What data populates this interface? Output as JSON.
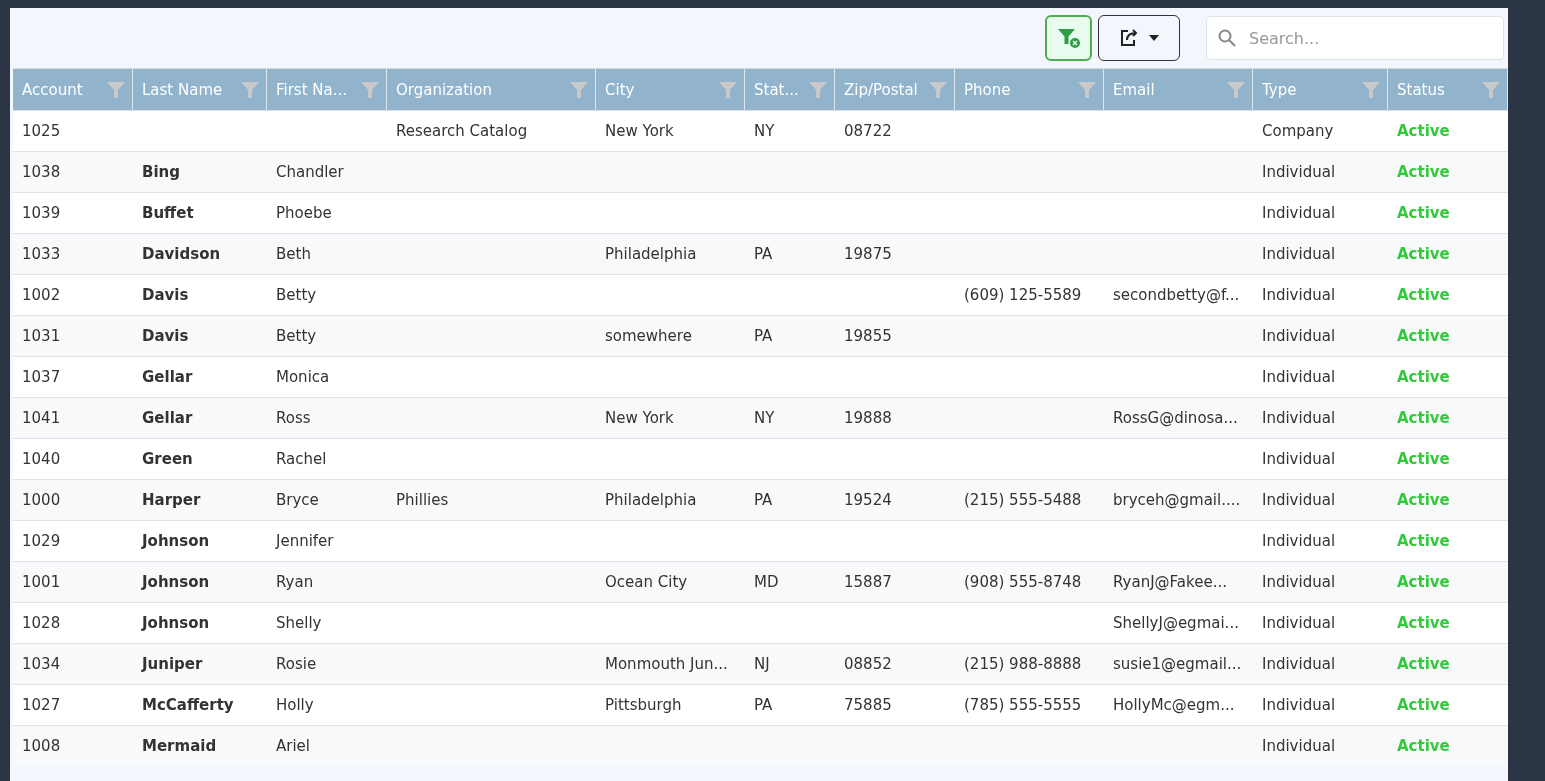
{
  "toolbar": {
    "clear_filter_active": true,
    "search": {
      "placeholder": "Search..."
    }
  },
  "table": {
    "columns": [
      {
        "label": "Account",
        "filter": true
      },
      {
        "label": "Last Name",
        "filter": true
      },
      {
        "label": "First Na...",
        "filter": true
      },
      {
        "label": "Organization",
        "filter": true
      },
      {
        "label": "City",
        "filter": true
      },
      {
        "label": "Stat...",
        "filter": true
      },
      {
        "label": "Zip/Postal",
        "filter": true
      },
      {
        "label": "Phone",
        "filter": true
      },
      {
        "label": "Email",
        "filter": true
      },
      {
        "label": "Type",
        "filter": true
      },
      {
        "label": "Status",
        "filter": true
      }
    ],
    "rows": [
      [
        "1025",
        "",
        "",
        "Research Catalog",
        "New York",
        "NY",
        "08722",
        "",
        "",
        "Company",
        "Active"
      ],
      [
        "1038",
        "Bing",
        "Chandler",
        "",
        "",
        "",
        "",
        "",
        "",
        "Individual",
        "Active"
      ],
      [
        "1039",
        "Buffet",
        "Phoebe",
        "",
        "",
        "",
        "",
        "",
        "",
        "Individual",
        "Active"
      ],
      [
        "1033",
        "Davidson",
        "Beth",
        "",
        "Philadelphia",
        "PA",
        "19875",
        "",
        "",
        "Individual",
        "Active"
      ],
      [
        "1002",
        "Davis",
        "Betty",
        "",
        "",
        "",
        "",
        "(609) 125-5589",
        "secondbetty@f...",
        "Individual",
        "Active"
      ],
      [
        "1031",
        "Davis",
        "Betty",
        "",
        "somewhere",
        "PA",
        "19855",
        "",
        "",
        "Individual",
        "Active"
      ],
      [
        "1037",
        "Gellar",
        "Monica",
        "",
        "",
        "",
        "",
        "",
        "",
        "Individual",
        "Active"
      ],
      [
        "1041",
        "Gellar",
        "Ross",
        "",
        "New York",
        "NY",
        "19888",
        "",
        "RossG@dinosa...",
        "Individual",
        "Active"
      ],
      [
        "1040",
        "Green",
        "Rachel",
        "",
        "",
        "",
        "",
        "",
        "",
        "Individual",
        "Active"
      ],
      [
        "1000",
        "Harper",
        "Bryce",
        "Phillies",
        "Philadelphia",
        "PA",
        "19524",
        "(215) 555-5488",
        "bryceh@gmail....",
        "Individual",
        "Active"
      ],
      [
        "1029",
        "Johnson",
        "Jennifer",
        "",
        "",
        "",
        "",
        "",
        "",
        "Individual",
        "Active"
      ],
      [
        "1001",
        "Johnson",
        "Ryan",
        "",
        "Ocean City",
        "MD",
        "15887",
        "(908) 555-8748",
        "RyanJ@Fakee...",
        "Individual",
        "Active"
      ],
      [
        "1028",
        "Johnson",
        "Shelly",
        "",
        "",
        "",
        "",
        "",
        "ShellyJ@egmai...",
        "Individual",
        "Active"
      ],
      [
        "1034",
        "Juniper",
        "Rosie",
        "",
        "Monmouth Jun...",
        "NJ",
        "08852",
        "(215) 988-8888",
        "susie1@egmail...",
        "Individual",
        "Active"
      ],
      [
        "1027",
        "McCafferty",
        "Holly",
        "",
        "Pittsburgh",
        "PA",
        "75885",
        "(785) 555-5555",
        "HollyMc@egm...",
        "Individual",
        "Active"
      ],
      [
        "1008",
        "Mermaid",
        "Ariel",
        "",
        "",
        "",
        "",
        "",
        "",
        "Individual",
        "Active"
      ]
    ]
  }
}
